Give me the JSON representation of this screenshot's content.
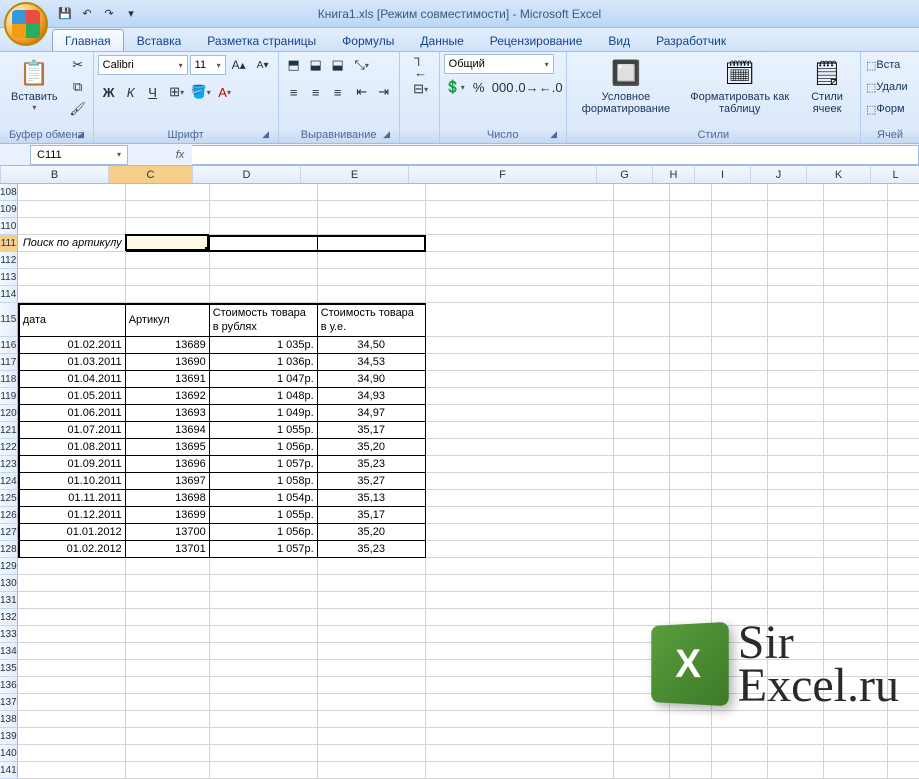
{
  "title": "Книга1.xls  [Режим совместимости] - Microsoft Excel",
  "tabs": [
    "Главная",
    "Вставка",
    "Разметка страницы",
    "Формулы",
    "Данные",
    "Рецензирование",
    "Вид",
    "Разработчик"
  ],
  "active_tab": 0,
  "ribbon": {
    "clipboard": {
      "label": "Буфер обмена",
      "paste": "Вставить"
    },
    "font": {
      "label": "Шрифт",
      "name": "Calibri",
      "size": "11",
      "bold": "Ж",
      "italic": "К",
      "underline": "Ч"
    },
    "alignment": {
      "label": "Выравнивание"
    },
    "number": {
      "label": "Число",
      "format": "Общий"
    },
    "styles": {
      "label": "Стили",
      "cond": "Условное форматирование",
      "table": "Форматировать как таблицу",
      "cell": "Стили ячеек"
    },
    "cells": {
      "label": "Ячей",
      "insert": "Вста",
      "delete": "Удали",
      "format": "Форм"
    }
  },
  "namebox": "C111",
  "columns": [
    {
      "l": "B",
      "w": 108
    },
    {
      "l": "C",
      "w": 84
    },
    {
      "l": "D",
      "w": 108
    },
    {
      "l": "E",
      "w": 108
    },
    {
      "l": "F",
      "w": 188
    },
    {
      "l": "G",
      "w": 56
    },
    {
      "l": "H",
      "w": 42
    },
    {
      "l": "I",
      "w": 56
    },
    {
      "l": "J",
      "w": 56
    },
    {
      "l": "K",
      "w": 64
    },
    {
      "l": "L",
      "w": 50
    }
  ],
  "sel_col": 1,
  "rows_start": 108,
  "rows_end": 141,
  "sel_row": 111,
  "search_label": "Поиск по артикулу",
  "headers": [
    "дата",
    "Артикул",
    "Стоимость товара в рублях",
    "Стоимость товара в у.е."
  ],
  "table": [
    [
      "01.02.2011",
      "13689",
      "1 035р.",
      "34,50"
    ],
    [
      "01.03.2011",
      "13690",
      "1 036р.",
      "34,53"
    ],
    [
      "01.04.2011",
      "13691",
      "1 047р.",
      "34,90"
    ],
    [
      "01.05.2011",
      "13692",
      "1 048р.",
      "34,93"
    ],
    [
      "01.06.2011",
      "13693",
      "1 049р.",
      "34,97"
    ],
    [
      "01.07.2011",
      "13694",
      "1 055р.",
      "35,17"
    ],
    [
      "01.08.2011",
      "13695",
      "1 056р.",
      "35,20"
    ],
    [
      "01.09.2011",
      "13696",
      "1 057р.",
      "35,23"
    ],
    [
      "01.10.2011",
      "13697",
      "1 058р.",
      "35,27"
    ],
    [
      "01.11.2011",
      "13698",
      "1 054р.",
      "35,13"
    ],
    [
      "01.12.2011",
      "13699",
      "1 055р.",
      "35,17"
    ],
    [
      "01.01.2012",
      "13700",
      "1 056р.",
      "35,20"
    ],
    [
      "01.02.2012",
      "13701",
      "1 057р.",
      "35,23"
    ]
  ],
  "watermark": {
    "line1": "Sir",
    "line2": "Excel.ru",
    "logo": "X"
  }
}
